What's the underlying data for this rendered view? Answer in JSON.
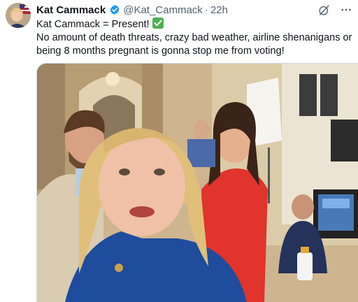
{
  "author": {
    "name": "Kat Cammack",
    "handle": "@Kat_Cammack",
    "separator": "·",
    "time": "22h"
  },
  "tweet": {
    "line1": "Kat Cammack = Present!",
    "line2": "No amount of death threats, crazy bad weather, airline shenanigans or",
    "line3": "being 8 months pregnant is gonna stop me from voting!"
  },
  "icons": {
    "verified": "verified-badge-icon",
    "grok": "grok-icon",
    "more": "more-icon",
    "check": "check-mark-icon"
  },
  "colors": {
    "verified": "#1d9bf0",
    "secondary_text": "#536471",
    "check_box": "#4caf50"
  }
}
